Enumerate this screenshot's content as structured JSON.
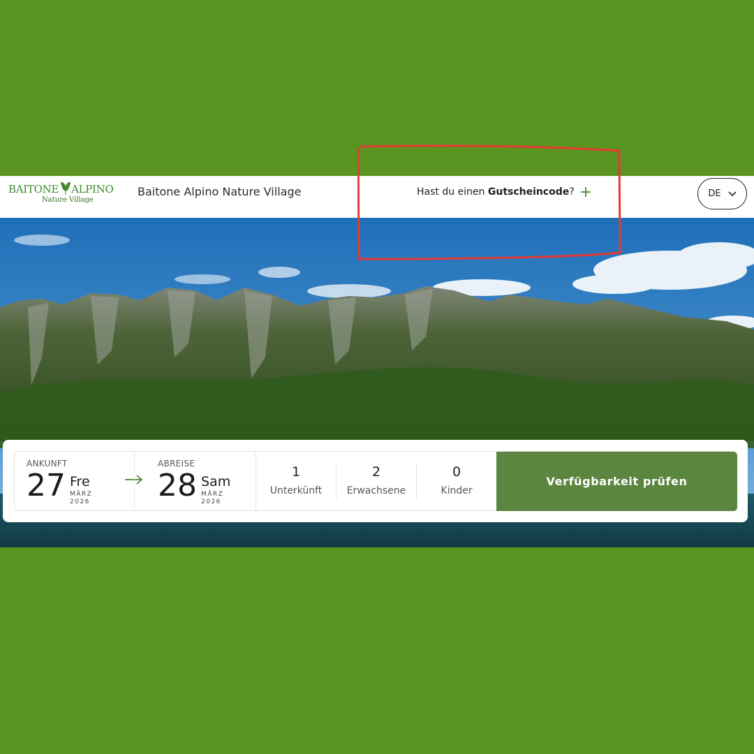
{
  "header": {
    "logo_text": "BAITONE ALPINO",
    "logo_subtitle": "Nature Village",
    "site_title": "Baitone Alpino Nature Village",
    "voucher_prefix": "Hast du einen ",
    "voucher_bold": "Gutscheincode",
    "voucher_suffix": "?",
    "language": "DE"
  },
  "booking": {
    "arrival": {
      "label": "ANKUNFT",
      "day_number": "27",
      "weekday": "Fre",
      "month": "MÄRZ",
      "year": "2026"
    },
    "departure": {
      "label": "ABREISE",
      "day_number": "28",
      "weekday": "Sam",
      "month": "MÄRZ",
      "year": "2026"
    },
    "counters": [
      {
        "value": "1",
        "label": "Unterkünft"
      },
      {
        "value": "2",
        "label": "Erwachsene"
      },
      {
        "value": "0",
        "label": "Kinder"
      }
    ],
    "cta_label": "Verfügbarkeit prüfen"
  },
  "colors": {
    "page_background": "#5a9420",
    "brand_green": "#3f8a2a",
    "cta_green": "#5b8640",
    "annotation_red": "#e53935"
  },
  "icons": {
    "voucher_toggle": "plus-icon",
    "language_dropdown": "chevron-down-icon",
    "date_range": "arrow-right-icon"
  }
}
